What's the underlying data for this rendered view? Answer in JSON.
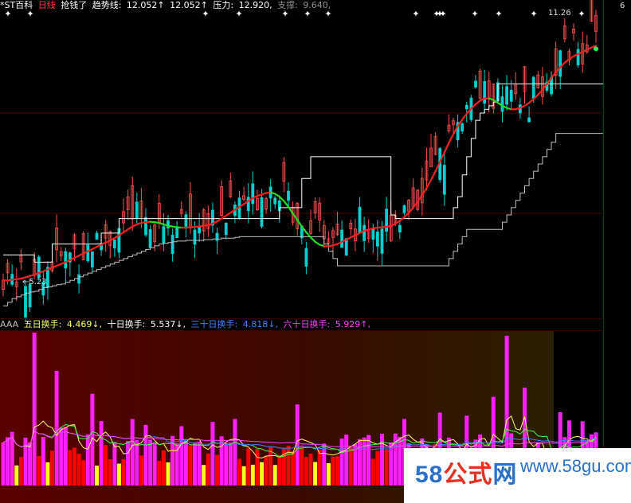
{
  "header": {
    "stock_name": "*ST百科",
    "period": "日线",
    "signal": "抢钱了",
    "trend_label": "趋势线:",
    "trend_value": "12.052↑",
    "trend_value2": "12.052↑",
    "pressure_label": "压力:",
    "pressure_value": "12.920,",
    "support_label": "支撑:",
    "support_value": "9.640,"
  },
  "price_labels": {
    "low_marker": "←5.23",
    "high_marker": "11.26",
    "right_edge": "6"
  },
  "indicator_header": {
    "name": "AAA",
    "ma5_label": "五日换手:",
    "ma5_value": "4.469↓,",
    "ma10_label": "十日换手:",
    "ma10_value": "5.537↓,",
    "ma30_label": "三十日换手:",
    "ma30_value": "4.818↓,",
    "ma60_label": "六十日换手:",
    "ma60_value": "5.929↑,"
  },
  "watermark": {
    "brand_58": "58",
    "brand_gs": "公式",
    "brand_net": "网",
    "url": "www.58gu.com"
  },
  "colors": {
    "background": "#000000",
    "trend_up": "#ff2020",
    "trend_down": "#20e020",
    "pressure": "#ffffff",
    "support": "#c0c0c0",
    "candle_up": "#ff5050",
    "candle_down": "#00d0d0",
    "volume_high": "#ff20ff",
    "volume_mid": "#ff0000",
    "volume_low": "#ffff20",
    "ma5": "#ffff60",
    "ma10": "#40ff40",
    "ma30": "#4080ff",
    "ma60": "#ff40ff"
  },
  "chart_data": [
    {
      "type": "line",
      "x": [
        "1",
        "2",
        "3",
        "4",
        "5",
        "6",
        "7",
        "8",
        "9",
        "10",
        "11",
        "12",
        "13",
        "14",
        "15",
        "16",
        "17",
        "18",
        "19",
        "20",
        "21",
        "22",
        "23",
        "24",
        "25",
        "26",
        "27",
        "28",
        "29",
        "30",
        "31",
        "32",
        "33",
        "34",
        "35",
        "36",
        "37",
        "38",
        "39",
        "40",
        "41",
        "42",
        "43",
        "44",
        "45",
        "46",
        "47",
        "48",
        "49",
        "50",
        "51",
        "52",
        "53",
        "54",
        "55",
        "56",
        "57",
        "58",
        "59",
        "60",
        "61",
        "62",
        "63",
        "64",
        "65",
        "66",
        "67",
        "68",
        "69",
        "70",
        "71",
        "72",
        "73",
        "74",
        "75",
        "76",
        "77",
        "78",
        "79",
        "80",
        "81",
        "82",
        "83",
        "84",
        "85",
        "86",
        "87",
        "88",
        "89",
        "90",
        "91",
        "92",
        "93",
        "94",
        "95",
        "96",
        "97",
        "98",
        "99",
        "100",
        "101",
        "102",
        "103",
        "104",
        "105",
        "106",
        "107",
        "108",
        "109",
        "110",
        "111",
        "112",
        "113",
        "114",
        "115",
        "116",
        "117",
        "118",
        "119",
        "120",
        "121",
        "122",
        "123",
        "124",
        "125",
        "126",
        "127",
        "128",
        "129",
        "130",
        "131",
        "132",
        "133",
        "134",
        "135",
        "136",
        "137",
        "138",
        "139",
        "140",
        "141",
        "142",
        "143",
        "144",
        "145",
        "146",
        "147",
        "148",
        "149",
        "150"
      ],
      "series": [
        {
          "name": "趋势线",
          "values": [
            5.6,
            5.6,
            5.62,
            5.63,
            5.65,
            5.68,
            5.72,
            5.75,
            5.8,
            5.85,
            5.9,
            5.95,
            6.0,
            6.05,
            6.1,
            6.16,
            6.22,
            6.28,
            6.34,
            6.4,
            6.46,
            6.52,
            6.58,
            6.64,
            6.7,
            6.76,
            6.84,
            6.92,
            7.0,
            7.08,
            7.14,
            7.18,
            7.2,
            7.21,
            7.2,
            7.18,
            7.14,
            7.1,
            7.08,
            7.06,
            7.05,
            7.05,
            7.06,
            7.07,
            7.08,
            7.1,
            7.12,
            7.16,
            7.22,
            7.3,
            7.38,
            7.46,
            7.54,
            7.62,
            7.7,
            7.78,
            7.86,
            7.92,
            7.96,
            8.0,
            8.02,
            7.98,
            7.9,
            7.78,
            7.62,
            7.44,
            7.26,
            7.08,
            6.92,
            6.78,
            6.66,
            6.58,
            6.54,
            6.54,
            6.56,
            6.6,
            6.66,
            6.72,
            6.78,
            6.84,
            6.9,
            6.96,
            7.0,
            7.03,
            7.05,
            7.06,
            7.07,
            7.1,
            7.16,
            7.24,
            7.34,
            7.46,
            7.6,
            7.76,
            7.94,
            8.14,
            8.36,
            8.6,
            8.86,
            9.12,
            9.38,
            9.62,
            9.84,
            10.02,
            10.18,
            10.32,
            10.44,
            10.54,
            10.6,
            10.6,
            10.56,
            10.48,
            10.4,
            10.34,
            10.3,
            10.3,
            10.34,
            10.4,
            10.48,
            10.58,
            10.7,
            10.84,
            11.0,
            11.16,
            11.32,
            11.46,
            11.58,
            11.68,
            11.76,
            11.82,
            11.88,
            11.94,
            12.0,
            12.05
          ]
        },
        {
          "name": "压力",
          "values": [
            6.3,
            6.3,
            6.3,
            6.3,
            6.3,
            6.3,
            6.3,
            6.1,
            6.1,
            6.1,
            6.1,
            6.6,
            6.6,
            6.6,
            6.6,
            6.6,
            6.6,
            6.6,
            6.6,
            6.6,
            6.6,
            6.6,
            6.9,
            6.9,
            6.9,
            6.9,
            7.3,
            7.3,
            7.3,
            7.3,
            7.3,
            7.3,
            7.3,
            7.3,
            7.3,
            7.3,
            7.3,
            7.3,
            7.3,
            7.3,
            7.3,
            7.3,
            7.3,
            7.3,
            7.3,
            7.3,
            7.3,
            7.3,
            7.3,
            7.3,
            7.3,
            7.3,
            7.3,
            7.3,
            7.3,
            7.3,
            7.3,
            7.3,
            7.3,
            7.3,
            7.3,
            7.3,
            7.6,
            7.6,
            7.6,
            7.6,
            7.6,
            8.4,
            8.4,
            9.0,
            9.0,
            9.0,
            9.0,
            9.0,
            9.0,
            9.0,
            9.0,
            9.0,
            9.0,
            9.0,
            9.0,
            9.0,
            9.0,
            9.0,
            9.0,
            9.0,
            9.0,
            7.4,
            7.3,
            7.3,
            7.3,
            7.3,
            7.3,
            7.3,
            7.3,
            7.3,
            7.3,
            7.3,
            7.3,
            7.3,
            7.3,
            7.6,
            7.9,
            8.5,
            9.0,
            9.5,
            10.0,
            10.2,
            10.3,
            10.4,
            10.5,
            11.0,
            11.0,
            11.0,
            11.0,
            11.0,
            11.0,
            11.0,
            11.0,
            11.0,
            11.0,
            11.0,
            11.0,
            11.0,
            11.0,
            11.0,
            11.0,
            11.0,
            11.0,
            11.0,
            11.0,
            11.0,
            11.0,
            11.0,
            11.0,
            11.0,
            11.0,
            11.0,
            11.0,
            11.0,
            11.4,
            11.8,
            12.2,
            12.6,
            12.92
          ]
        },
        {
          "name": "支撑",
          "values": [
            4.9,
            5.0,
            5.1,
            5.15,
            5.2,
            5.25,
            5.28,
            5.3,
            5.35,
            5.4,
            5.42,
            5.45,
            5.48,
            5.5,
            5.55,
            5.6,
            5.65,
            5.7,
            5.75,
            5.8,
            5.85,
            5.9,
            5.95,
            6.0,
            6.05,
            6.1,
            6.15,
            6.2,
            6.25,
            6.3,
            6.35,
            6.4,
            6.45,
            6.5,
            6.55,
            6.6,
            6.62,
            6.64,
            6.66,
            6.68,
            6.68,
            6.7,
            6.7,
            6.7,
            6.7,
            6.72,
            6.72,
            6.74,
            6.74,
            6.76,
            6.76,
            6.76,
            6.78,
            6.8,
            6.8,
            6.8,
            6.8,
            6.8,
            6.8,
            6.8,
            6.8,
            6.8,
            6.8,
            6.8,
            6.8,
            6.8,
            6.8,
            6.8,
            6.8,
            6.8,
            6.8,
            6.8,
            6.6,
            6.4,
            6.2,
            6.0,
            6.0,
            6.0,
            6.0,
            6.0,
            6.0,
            6.0,
            6.0,
            6.0,
            6.0,
            6.0,
            6.0,
            6.0,
            6.0,
            6.0,
            6.0,
            6.0,
            6.0,
            6.0,
            6.0,
            6.0,
            6.0,
            6.0,
            6.0,
            6.0,
            6.2,
            6.4,
            6.6,
            6.8,
            7.0,
            7.0,
            7.0,
            7.0,
            7.0,
            7.0,
            7.0,
            7.0,
            7.2,
            7.4,
            7.6,
            7.8,
            8.0,
            8.2,
            8.4,
            8.6,
            8.8,
            9.0,
            9.2,
            9.4,
            9.64,
            9.64,
            9.64,
            9.64,
            9.64,
            9.64,
            9.64,
            9.64,
            9.64,
            9.64,
            9.64,
            9.64,
            9.64,
            9.64,
            9.64,
            9.64,
            9.64,
            9.64,
            9.64,
            9.64,
            9.64,
            9.64,
            9.64,
            9.64,
            9.64,
            9.64
          ]
        }
      ],
      "ylim": [
        4.6,
        13.0
      ],
      "grid": false
    },
    {
      "type": "bar",
      "x": [
        "1",
        "150"
      ],
      "series": [
        {
          "name": "五日换手",
          "values": [
            4.469
          ]
        },
        {
          "name": "十日换手",
          "values": [
            5.537
          ]
        },
        {
          "name": "三十日换手",
          "values": [
            4.818
          ]
        },
        {
          "name": "六十日换手",
          "values": [
            5.929
          ]
        }
      ],
      "legend": "top-left",
      "grid": false
    }
  ]
}
